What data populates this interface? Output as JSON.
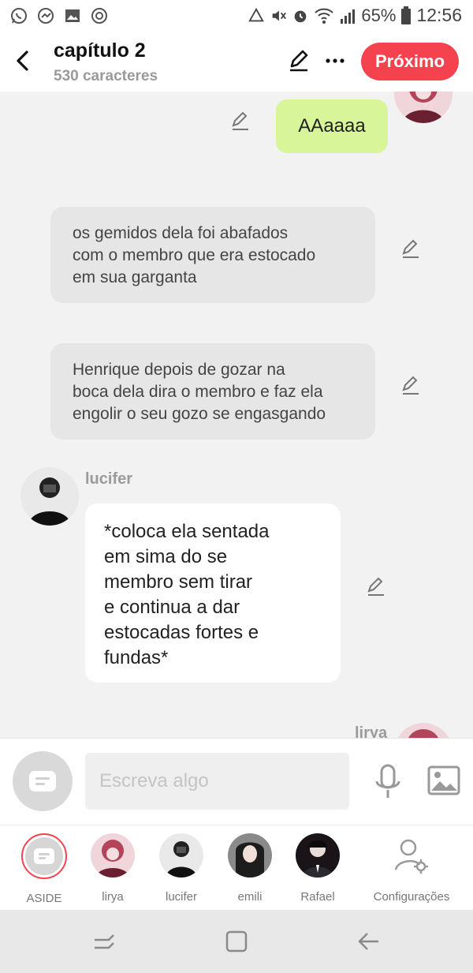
{
  "status_bar": {
    "battery": "65%",
    "time": "12:56",
    "icons": [
      "whatsapp-icon",
      "messenger-icon",
      "gallery-icon",
      "sync-icon",
      "data-saver-icon",
      "mute-icon",
      "alarm-icon",
      "wifi-icon",
      "signal-icon",
      "battery-icon"
    ]
  },
  "header": {
    "title": "capítulo 2",
    "subtitle": "530 caracteres",
    "next_label": "Próximo"
  },
  "chat": {
    "messages": [
      {
        "type": "outgoing",
        "text": "AAaaaa",
        "color": "#d8f59a"
      },
      {
        "type": "narration",
        "lines": [
          "os gemidos  dela foi abafados",
          "com o membro que era estocado",
          "em sua garganta"
        ]
      },
      {
        "type": "narration",
        "lines": [
          "Henrique depois de gozar na",
          "boca dela dira o membro e faz ela",
          "engolir o seu gozo se engasgando"
        ]
      },
      {
        "type": "character",
        "name": "lucifer",
        "lines": [
          "*coloca ela sentada",
          "em sima do se",
          "membro sem tirar",
          "e continua a dar",
          "estocadas fortes e",
          "fundas*"
        ]
      },
      {
        "type": "character",
        "name": "lirya"
      }
    ]
  },
  "input": {
    "placeholder": "Escreva algo"
  },
  "characters": [
    {
      "name": "ASIDE",
      "selected": true
    },
    {
      "name": "lirya"
    },
    {
      "name": "lucifer"
    },
    {
      "name": "emili"
    },
    {
      "name": "Rafael"
    },
    {
      "name": "Configurações"
    }
  ],
  "colors": {
    "accent": "#f5424f",
    "outgoing_bubble": "#d8f59a",
    "narration_bubble": "#e6e6e6"
  }
}
